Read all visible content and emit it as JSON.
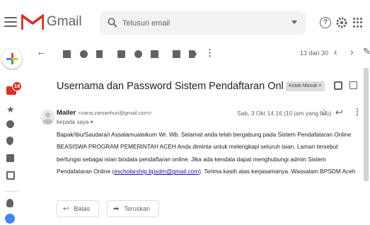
{
  "header": {
    "app_name": "Gmail",
    "search": {
      "placeholder": "Telusuri email"
    }
  },
  "rail": {
    "inbox_badge": "18"
  },
  "toolbar": {
    "pager_text": "13 dari 30"
  },
  "message": {
    "subject": "Usernama dan Password Sistem Pendaftaran Online Beasisw",
    "label_chip": "Kotak Masuk ×",
    "sender_name": "Mailer",
    "sender_email": "<nana.zamanhuri@gmail.com>",
    "to_line": "kepada saya ▾",
    "date": "Sab, 3 Okt 14.16 (10 jam yang lalu)",
    "body_part1": "Bapak/Ibu/Saudara/i Assalamualaikum Wr. Wb. Selamat anda telah bergabung pada Sistem Pendafataran Online BEASISWA PROGRAM PEMERINTAH ACEH Anda diminta untuk melengkapi seluruh isian. Laman tersebut berfungsi sebagai isian biodata pendaftaran online. Jika ada kendala dapat menghubungi admin Sistem Pendafataran Online (",
    "body_link": "escholarship.bpsdm@gmail.com",
    "body_part2": "). Terima kasih atas kerjasamanya. Wassalam BPSDM Aceh"
  },
  "actions": {
    "reply_label": "Balas",
    "forward_label": "Teruskan"
  },
  "colors": {
    "gmail_red": "#d93025",
    "link": "#1a0dab",
    "icon_gray": "#5f6368"
  }
}
